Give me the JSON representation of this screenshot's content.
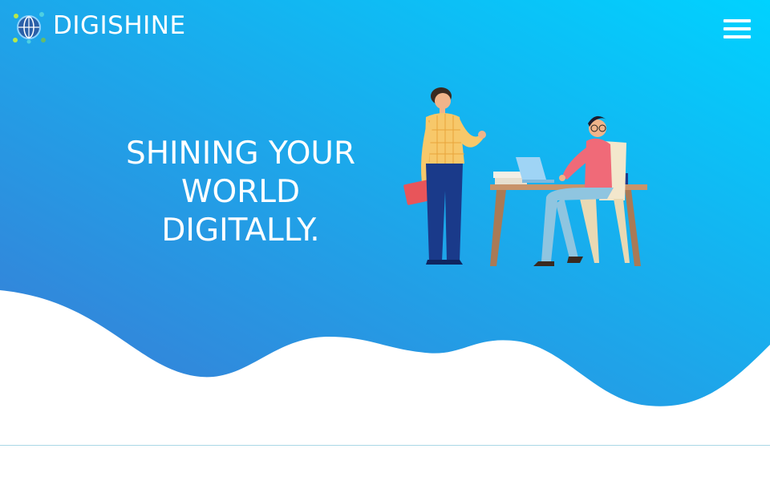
{
  "brand": {
    "name": "DIGISHINE",
    "logo_icon": "globe-network-icon"
  },
  "header": {
    "menu_icon": "hamburger-menu-icon"
  },
  "hero": {
    "headline_lines": [
      "SHINING YOUR",
      "WORLD",
      "DIGITALLY."
    ],
    "illustration": "people-working-illustration",
    "gradient_start": "#3a7bd5",
    "gradient_end": "#00d2ff"
  },
  "colors": {
    "text_on_hero": "#ffffff",
    "divider": "#a9d8e6",
    "page_background": "#ffffff"
  }
}
